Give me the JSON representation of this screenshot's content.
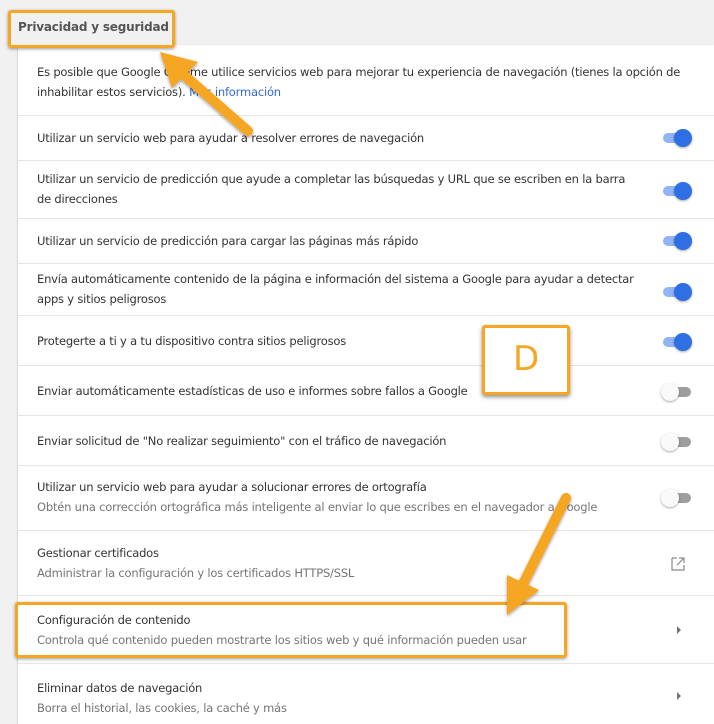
{
  "section": {
    "title": "Privacidad y seguridad"
  },
  "intro": {
    "text": "Es posible que Google Chrome utilice servicios web para mejorar tu experiencia de navegación (tienes la opción de inhabilitar estos servicios).",
    "link": "Más información"
  },
  "settings": [
    {
      "label": "Utilizar un servicio web para ayudar a resolver errores de navegación",
      "enabled": true
    },
    {
      "label": "Utilizar un servicio de predicción que ayude a completar las búsquedas y URL que se escriben en la barra de direcciones",
      "enabled": true
    },
    {
      "label": "Utilizar un servicio de predicción para cargar las páginas más rápido",
      "enabled": true
    },
    {
      "label": "Envía automáticamente contenido de la página e información del sistema a Google para ayudar a detectar apps y sitios peligrosos",
      "enabled": true
    },
    {
      "label": "Protegerte a ti y a tu dispositivo contra sitios peligrosos",
      "enabled": true
    },
    {
      "label": "Enviar automáticamente estadísticas de uso e informes sobre fallos a Google",
      "enabled": false
    },
    {
      "label": "Enviar solicitud de \"No realizar seguimiento\" con el tráfico de navegación",
      "enabled": false
    },
    {
      "label": "Utilizar un servicio web para ayudar a solucionar errores de ortografía",
      "sublabel": "Obtén una corrección ortográfica más inteligente al enviar lo que escribes en el navegador a Google",
      "enabled": false
    }
  ],
  "links": [
    {
      "label": "Gestionar certificados",
      "sublabel": "Administrar la configuración y los certificados HTTPS/SSL",
      "icon": "external-link-icon"
    },
    {
      "label": "Configuración de contenido",
      "sublabel": "Controla qué contenido pueden mostrarte los sitios web y qué información pueden usar",
      "icon": "chevron-right-icon"
    },
    {
      "label": "Eliminar datos de navegación",
      "sublabel": "Borra el historial, las cookies, la caché y más",
      "icon": "chevron-right-icon"
    }
  ],
  "callout": {
    "letter": "D"
  },
  "colors": {
    "accent": "#f5a623",
    "toggle_on": "#2f6fe4",
    "link": "#3367d6"
  }
}
